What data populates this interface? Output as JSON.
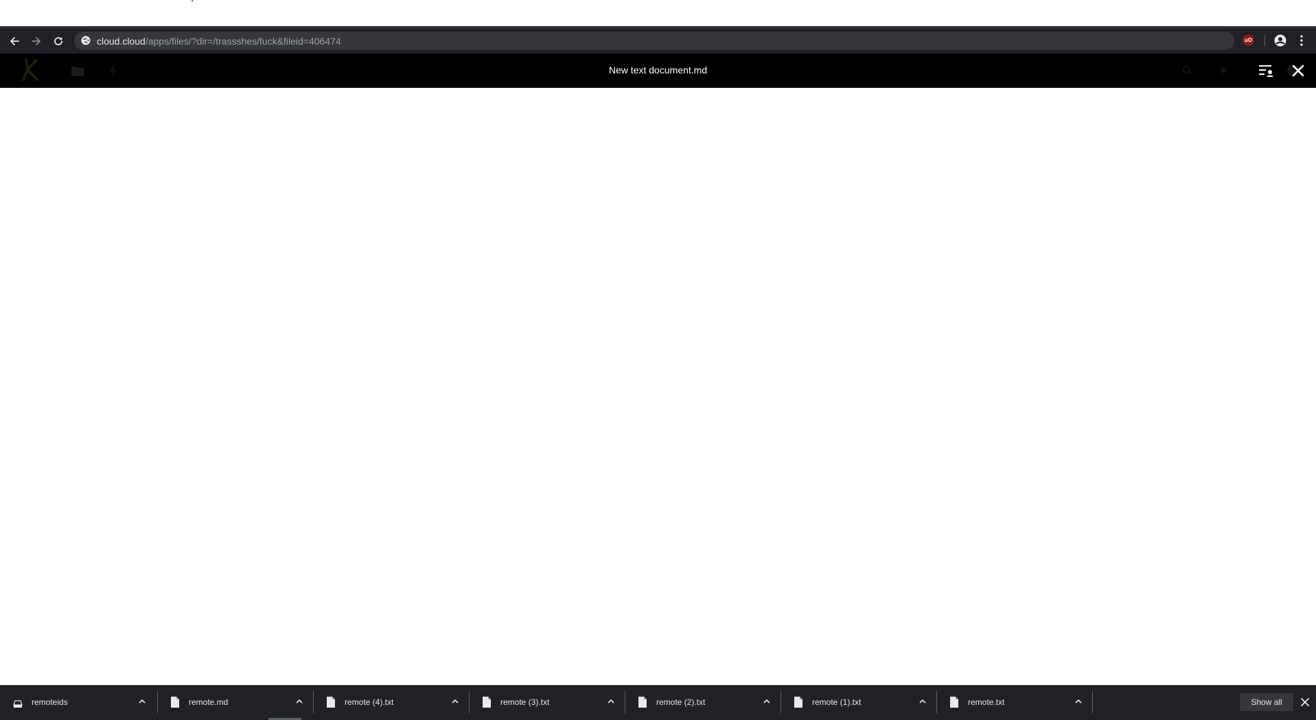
{
  "browser": {
    "url_host": "cloud.cloud",
    "url_path": "/apps/files/?dir=/trassshes/fuck&fileid=406474",
    "extension_badge": "uO",
    "icons": {
      "back": "arrow-left-icon",
      "forward": "arrow-right-icon",
      "reload": "reload-icon",
      "site_info": "globe-icon",
      "profile": "account-circle-icon",
      "menu": "more-vert-icon"
    }
  },
  "viewer": {
    "title": "New text document.md",
    "icons": {
      "sidebar": "sidebar-toggle-icon",
      "close": "close-icon"
    }
  },
  "downloads": {
    "items": [
      {
        "name": "remoteids",
        "icon": "drive-icon"
      },
      {
        "name": "remote.md",
        "icon": "file-icon"
      },
      {
        "name": "remote (4).txt",
        "icon": "file-icon"
      },
      {
        "name": "remote (3).txt",
        "icon": "file-icon"
      },
      {
        "name": "remote (2).txt",
        "icon": "file-icon"
      },
      {
        "name": "remote (1).txt",
        "icon": "file-icon"
      },
      {
        "name": "remote.txt",
        "icon": "file-icon"
      }
    ],
    "show_all_label": "Show all"
  },
  "colors": {
    "toolbar_bg": "#202124",
    "omnibox_bg": "#35363a",
    "viewer_bar_bg": "#000000",
    "content_bg": "#ffffff",
    "extension_red": "#8b1a1a"
  }
}
